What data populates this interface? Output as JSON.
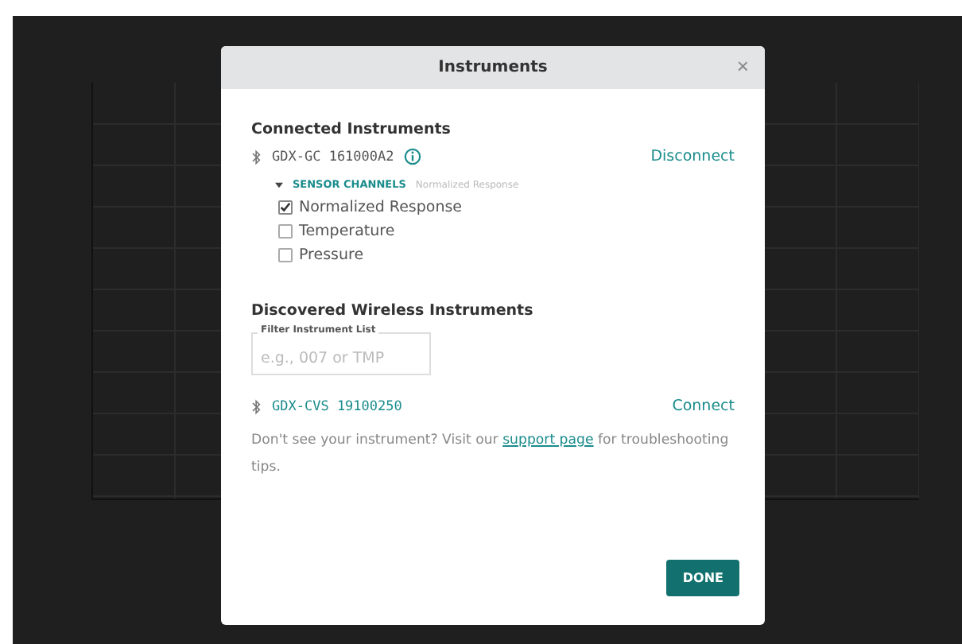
{
  "dialog": {
    "title": "Instruments",
    "close": "×",
    "connected": {
      "heading": "Connected Instruments",
      "device": "GDX-GC 161000A2",
      "action": "Disconnect",
      "channels_label": "SENSOR CHANNELS",
      "channels_summary": "Normalized Response",
      "expanded": true,
      "channels": [
        {
          "name": "Normalized Response",
          "checked": true
        },
        {
          "name": "Temperature",
          "checked": false
        },
        {
          "name": "Pressure",
          "checked": false
        }
      ]
    },
    "discovered": {
      "heading": "Discovered Wireless Instruments",
      "filter_label": "Filter Instrument List",
      "filter_placeholder": "e.g., 007 or TMP",
      "devices": [
        {
          "name": "GDX-CVS 19100250",
          "action": "Connect"
        }
      ]
    },
    "help": {
      "before": "Don't see your instrument? Visit our ",
      "link": "support page",
      "after": " for troubleshooting tips."
    },
    "done": "DONE"
  }
}
